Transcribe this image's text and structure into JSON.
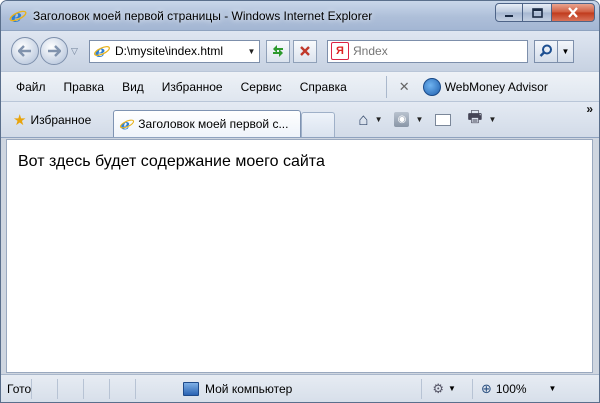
{
  "window": {
    "title": "Заголовок моей первой страницы - Windows Internet Explorer",
    "icon": "ie-logo-icon",
    "controls": [
      "minimize",
      "maximize",
      "close"
    ]
  },
  "navigation": {
    "address": "D:\\mysite\\index.html",
    "search_placeholder": "Яndex",
    "search_provider_icon": "yandex-icon"
  },
  "menu": {
    "items": [
      "Файл",
      "Правка",
      "Вид",
      "Избранное",
      "Сервис",
      "Справка"
    ],
    "addon_label": "WebMoney Advisor"
  },
  "tabs": {
    "favorites_label": "Избранное",
    "active_tab_label": "Заголовок моей первой с..."
  },
  "content": {
    "text": "Вот здесь будет содержание моего сайта"
  },
  "status": {
    "text": "Готово",
    "zone": "Мой компьютер",
    "zoom": "100%"
  },
  "colors": {
    "chrome_blue": "#aebfd9",
    "close_red": "#c0391b",
    "content_bg": "#ffffff"
  }
}
